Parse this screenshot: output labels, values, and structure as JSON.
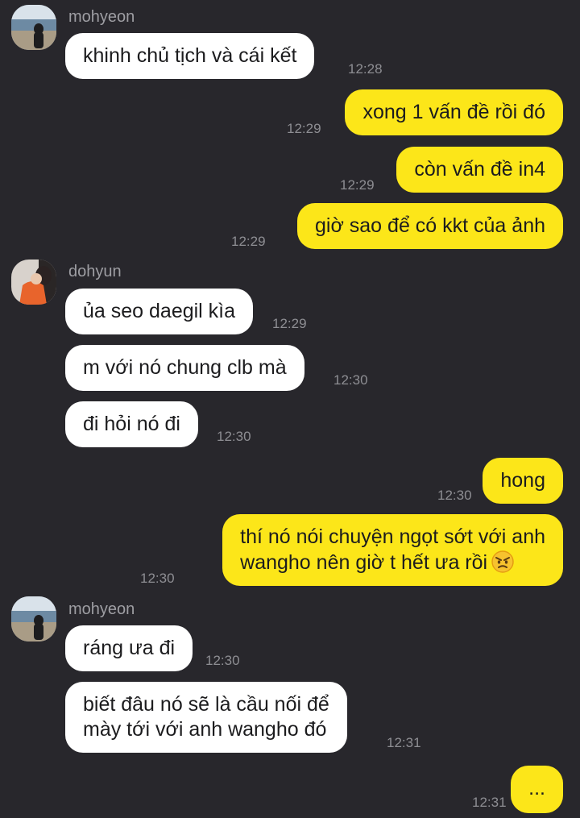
{
  "messages": [
    {
      "sender": "mohyeon",
      "text": "khinh chủ tịch và cái kết",
      "time": "12:28"
    },
    {
      "text": "xong 1 vấn đề rồi đó",
      "time": "12:29"
    },
    {
      "text": "còn vấn đề in4",
      "time": "12:29"
    },
    {
      "text": "giờ sao để có kkt của ảnh",
      "time": "12:29"
    },
    {
      "sender": "dohyun",
      "text": "ủa seo daegil kìa",
      "time": "12:29"
    },
    {
      "text": "m với nó chung clb mà",
      "time": "12:30"
    },
    {
      "text": "đi hỏi nó đi",
      "time": "12:30"
    },
    {
      "text": "hong",
      "time": "12:30"
    },
    {
      "lines": [
        "thí nó nói chuyện ngọt sớt với anh",
        "wangho nên giờ t hết ưa rồi"
      ],
      "emoji": "angry-face-emoji",
      "time": "12:30"
    },
    {
      "sender": "mohyeon",
      "text": "ráng ưa đi",
      "time": "12:30"
    },
    {
      "lines": [
        "biết đâu nó sẽ là cầu nối để",
        "mày tới với anh wangho đó"
      ],
      "time": "12:31"
    },
    {
      "text": "...",
      "time": "12:31"
    }
  ],
  "colors": {
    "background": "#28272c",
    "incoming_bubble": "#ffffff",
    "outgoing_bubble": "#fce619",
    "timestamp": "#8e8e93",
    "sender_name": "#9e9ea3"
  }
}
